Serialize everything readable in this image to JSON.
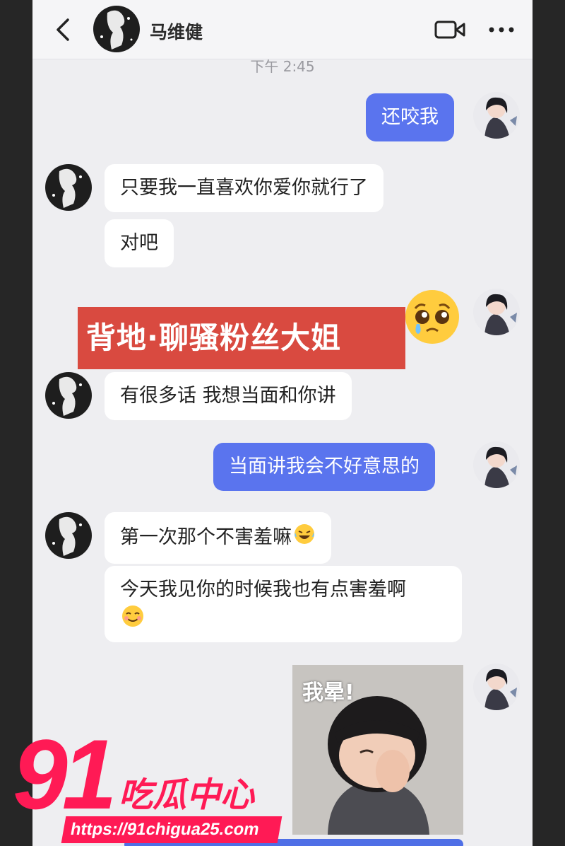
{
  "header": {
    "contact_name": "马维健",
    "back_icon": "chevron-left-icon",
    "video_icon": "video-call-icon",
    "more_icon": "more-dots-icon"
  },
  "timestamp": "下午 2:45",
  "messages": [
    {
      "side": "out",
      "text": "还咬我"
    },
    {
      "side": "in",
      "text": "只要我一直喜欢你爱你就行了"
    },
    {
      "side": "in",
      "text": "对吧"
    },
    {
      "side": "out",
      "emoji": "pleading-face"
    },
    {
      "side": "in",
      "text": "有很多话 我想当面和你讲"
    },
    {
      "side": "out",
      "text": "当面讲我会不好意思的"
    },
    {
      "side": "in",
      "text": "第一次那个不害羞嘛"
    },
    {
      "side": "in",
      "text": "今天我见你的时候我也有点害羞啊"
    },
    {
      "side": "out",
      "sticker_text": "我晕!"
    }
  ],
  "overlay_banner": "背地·聊骚粉丝大姐",
  "watermark": {
    "number": "91",
    "brand": "吃瓜中心",
    "url": "https://91chigua25.com"
  },
  "colors": {
    "outgoing_bubble": "#5a74ee",
    "incoming_bubble": "#ffffff",
    "background": "#eeeef1",
    "banner": "#d94a40",
    "watermark": "#ff1a55"
  }
}
